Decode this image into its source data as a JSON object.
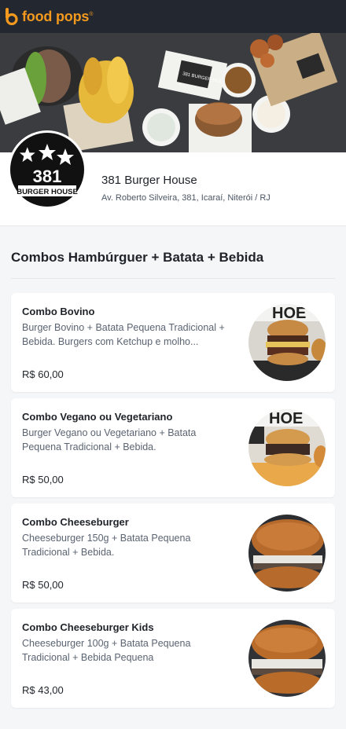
{
  "app": {
    "brand": "food pops",
    "trademark": "®"
  },
  "banner": {
    "label": "381 BURGER HOUSE"
  },
  "store": {
    "logo_number": "381",
    "logo_text": "BURGER HOUSE",
    "name": "381 Burger House",
    "address": "Av. Roberto Silveira, 381, Icaraí, Niterói / RJ"
  },
  "section": {
    "title": "Combos Hambúrguer + Batata + Bebida"
  },
  "items": [
    {
      "name": "Combo Bovino",
      "description": "Burger Bovino + Batata Pequena Tradicional + Bebida. Burgers com Ketchup e molho...",
      "price": "R$ 60,00"
    },
    {
      "name": "Combo Vegano ou Vegetariano",
      "description": "Burger Vegano ou Vegetariano + Batata Pequena Tradicional + Bebida.",
      "price": "R$ 50,00"
    },
    {
      "name": "Combo Cheeseburger",
      "description": "Cheeseburger 150g + Batata Pequena Tradicional + Bebida.",
      "price": "R$ 50,00"
    },
    {
      "name": "Combo Cheeseburger Kids",
      "description": "Cheeseburger 100g + Batata Pequena Tradicional + Bebida Pequena",
      "price": "R$ 43,00"
    }
  ],
  "colors": {
    "brand": "#f39a1e",
    "topbar": "#232730",
    "background": "#f5f6f8"
  },
  "icons": {
    "logo": "food-pops-logo-icon"
  }
}
